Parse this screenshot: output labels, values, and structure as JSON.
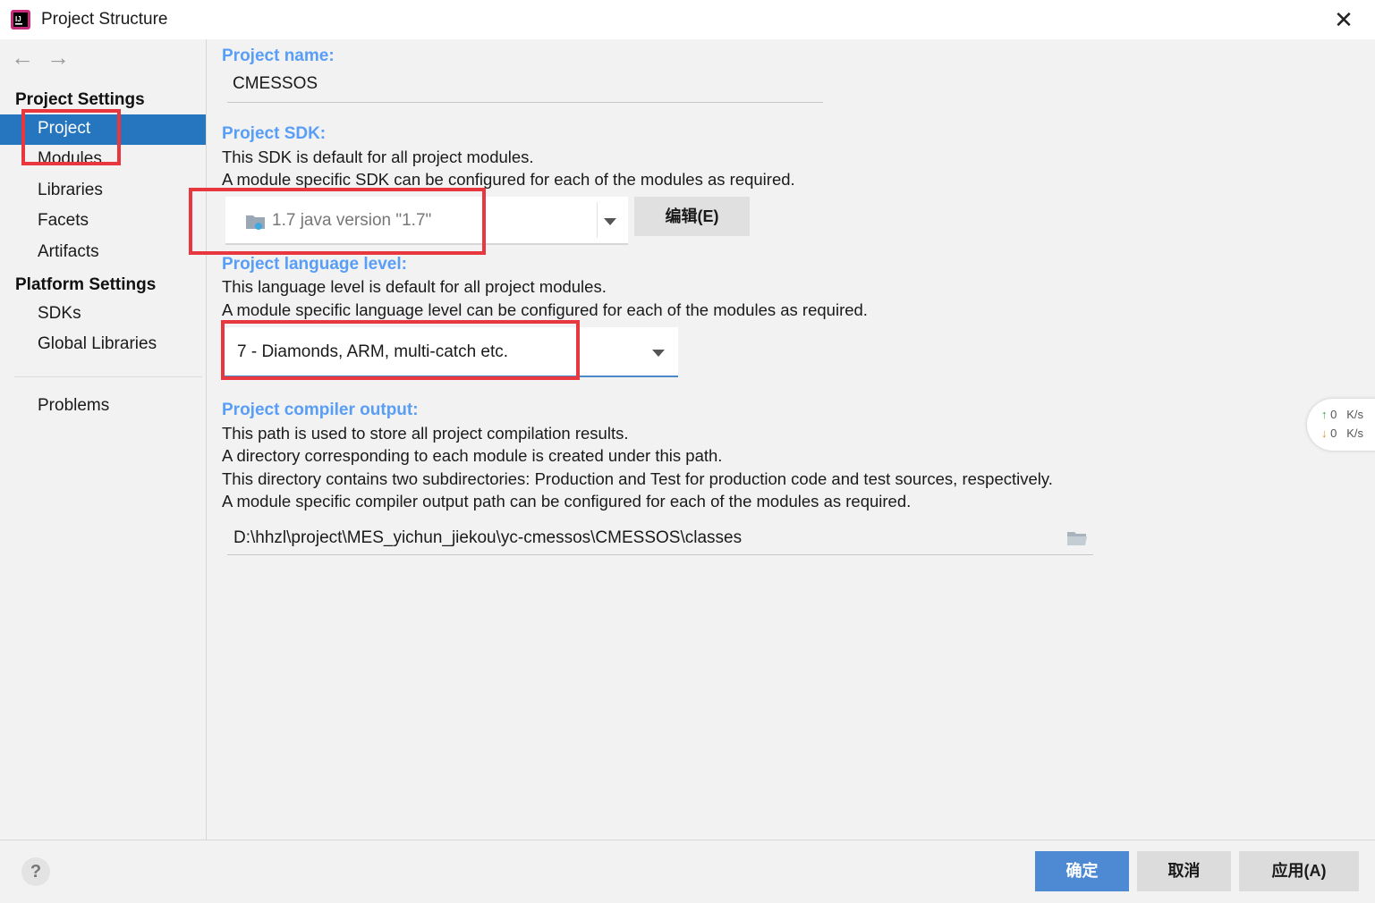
{
  "window": {
    "title": "Project Structure"
  },
  "sidebar": {
    "sections": [
      {
        "heading": "Project Settings",
        "items": [
          "Project",
          "Modules",
          "Libraries",
          "Facets",
          "Artifacts"
        ]
      },
      {
        "heading": "Platform Settings",
        "items": [
          "SDKs",
          "Global Libraries"
        ]
      }
    ],
    "problems": "Problems",
    "selected": "Project"
  },
  "main": {
    "name_label": "Project name:",
    "name_value": "CMESSOS",
    "sdk_label": "Project SDK:",
    "sdk_desc1": "This SDK is default for all project modules.",
    "sdk_desc2": "A module specific SDK can be configured for each of the modules as required.",
    "sdk_value": "1.7  java version \"1.7\"",
    "sdk_edit": "编辑(E)",
    "lang_label": "Project language level:",
    "lang_desc1": "This language level is default for all project modules.",
    "lang_desc2": "A module specific language level can be configured for each of the modules as required.",
    "lang_value": "7 - Diamonds, ARM, multi-catch etc.",
    "out_label": "Project compiler output:",
    "out_desc1": "This path is used to store all project compilation results.",
    "out_desc2": "A directory corresponding to each module is created under this path.",
    "out_desc3": "This directory contains two subdirectories: Production and Test for production code and test sources, respectively.",
    "out_desc4": "A module specific compiler output path can be configured for each of the modules as required.",
    "out_value": "D:\\hhzl\\project\\MES_yichun_jiekou\\yc-cmessos\\CMESSOS\\classes"
  },
  "net_widget": {
    "up_value": "0",
    "down_value": "0",
    "unit": "K/s"
  },
  "footer": {
    "help": "?",
    "ok": "确定",
    "cancel": "取消",
    "apply": "应用(A)"
  },
  "colors": {
    "accent": "#2675bf",
    "label": "#589df6",
    "highlight": "#e8373f"
  }
}
